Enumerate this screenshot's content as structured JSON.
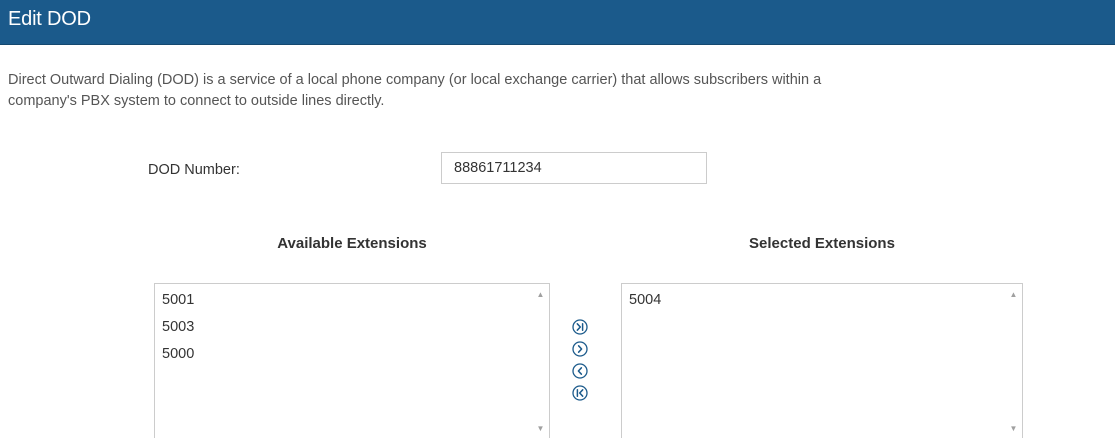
{
  "header": {
    "title": "Edit DOD"
  },
  "description": "Direct Outward Dialing (DOD) is a service of a local phone company (or local exchange carrier) that allows subscribers within a\ncompany's PBX system to connect to outside lines directly.",
  "dod": {
    "label": "DOD Number:",
    "value": "88861711234"
  },
  "available": {
    "header": "Available Extensions",
    "items": [
      "5001",
      "5003",
      "5000"
    ]
  },
  "selected": {
    "header": "Selected Extensions",
    "items": [
      "5004"
    ]
  },
  "move_buttons": [
    {
      "icon": "move-all-right-icon"
    },
    {
      "icon": "move-right-icon"
    },
    {
      "icon": "move-left-icon"
    },
    {
      "icon": "move-all-left-icon"
    }
  ],
  "colors": {
    "title_bar": "#1b5a8b",
    "icon": "#1b5a8b"
  }
}
